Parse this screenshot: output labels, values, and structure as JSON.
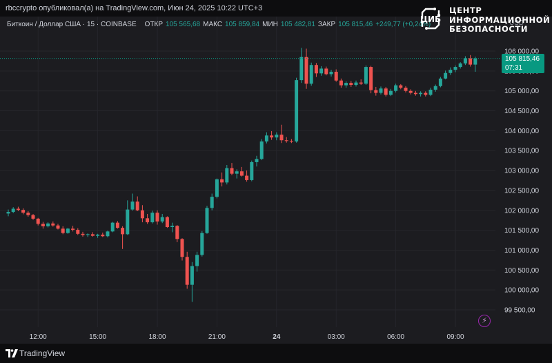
{
  "header": {
    "publisher_line": "rbccrypto опубликовал(а) на TradingView.com, Июн 24, 2025 10:22 UTC+3"
  },
  "legend": {
    "symbol": "Биткоин / Доллар США · 15 · COINBASE",
    "open_label": "ОТКР",
    "open_value": "105 565,68",
    "high_label": "МАКС",
    "high_value": "105 859,84",
    "low_label": "МИН",
    "low_value": "105 482,81",
    "close_label": "ЗАКР",
    "close_value": "105 815,46",
    "change": "+249,77 (+0,24%)"
  },
  "brand": {
    "line1": "ЦЕНТР",
    "line2": "ИНФОРМАЦИОННОЙ",
    "line3": "БЕЗОПАСНОСТИ",
    "emblem_text": "ЦИБ"
  },
  "price_axis": {
    "currency": "USD",
    "current_price": "105 815,46",
    "countdown": "07:31"
  },
  "footer": {
    "brand_name": "TradingView"
  },
  "colors": {
    "up": "#26a69a",
    "down": "#ef5350",
    "background": "#1c1c20",
    "price_tag": "#089981"
  },
  "icons": {
    "alert": "lightning-bolt-icon",
    "logo": "tradingview-logo-icon",
    "brand": "circuit-emblem-icon"
  },
  "chart_data": {
    "type": "candlestick",
    "timeframe_minutes": 15,
    "y_ticks": [
      99500,
      100000,
      100500,
      101000,
      101500,
      102000,
      102500,
      103000,
      103500,
      104000,
      104500,
      105000,
      105500,
      106000
    ],
    "y_tick_labels": [
      "99 500,00",
      "100 000,00",
      "100 500,00",
      "101 000,00",
      "101 500,00",
      "102 000,00",
      "102 500,00",
      "103 000,00",
      "103 500,00",
      "104 000,00",
      "104 500,00",
      "105 000,00",
      "105 500,00",
      "106 000,00"
    ],
    "x_tick_labels": [
      "12:00",
      "15:00",
      "18:00",
      "21:00",
      "24",
      "03:00",
      "06:00",
      "09:00"
    ],
    "x_tick_bar_index": [
      6,
      18,
      30,
      42,
      54,
      66,
      78,
      90
    ],
    "ylim": [
      99200,
      106300
    ],
    "last_price": 105815.46,
    "candles": [
      {
        "o": 101920,
        "h": 102020,
        "l": 101850,
        "c": 101960
      },
      {
        "o": 101960,
        "h": 102080,
        "l": 101930,
        "c": 102040
      },
      {
        "o": 102040,
        "h": 102090,
        "l": 101980,
        "c": 102010
      },
      {
        "o": 102010,
        "h": 102050,
        "l": 101900,
        "c": 101940
      },
      {
        "o": 101940,
        "h": 101980,
        "l": 101840,
        "c": 101880
      },
      {
        "o": 101880,
        "h": 101910,
        "l": 101760,
        "c": 101790
      },
      {
        "o": 101790,
        "h": 101810,
        "l": 101620,
        "c": 101660
      },
      {
        "o": 101660,
        "h": 101710,
        "l": 101540,
        "c": 101600
      },
      {
        "o": 101600,
        "h": 101700,
        "l": 101570,
        "c": 101670
      },
      {
        "o": 101670,
        "h": 101720,
        "l": 101590,
        "c": 101620
      },
      {
        "o": 101620,
        "h": 101660,
        "l": 101520,
        "c": 101540
      },
      {
        "o": 101540,
        "h": 101600,
        "l": 101400,
        "c": 101430
      },
      {
        "o": 101430,
        "h": 101560,
        "l": 101410,
        "c": 101540
      },
      {
        "o": 101540,
        "h": 101610,
        "l": 101470,
        "c": 101510
      },
      {
        "o": 101510,
        "h": 101550,
        "l": 101380,
        "c": 101410
      },
      {
        "o": 101410,
        "h": 101460,
        "l": 101340,
        "c": 101380
      },
      {
        "o": 101380,
        "h": 101420,
        "l": 101330,
        "c": 101400
      },
      {
        "o": 101400,
        "h": 101450,
        "l": 101340,
        "c": 101360
      },
      {
        "o": 101360,
        "h": 101410,
        "l": 101310,
        "c": 101390
      },
      {
        "o": 101390,
        "h": 101440,
        "l": 101330,
        "c": 101350
      },
      {
        "o": 101350,
        "h": 101490,
        "l": 101320,
        "c": 101470
      },
      {
        "o": 101470,
        "h": 101710,
        "l": 101450,
        "c": 101690
      },
      {
        "o": 101690,
        "h": 101730,
        "l": 101540,
        "c": 101560
      },
      {
        "o": 101560,
        "h": 101600,
        "l": 101030,
        "c": 101400
      },
      {
        "o": 101400,
        "h": 102250,
        "l": 101380,
        "c": 102020
      },
      {
        "o": 102020,
        "h": 102420,
        "l": 101990,
        "c": 102220
      },
      {
        "o": 102220,
        "h": 102350,
        "l": 101980,
        "c": 102000
      },
      {
        "o": 102000,
        "h": 102130,
        "l": 101700,
        "c": 101800
      },
      {
        "o": 101800,
        "h": 101910,
        "l": 101660,
        "c": 101700
      },
      {
        "o": 101700,
        "h": 101990,
        "l": 101670,
        "c": 101940
      },
      {
        "o": 101940,
        "h": 102000,
        "l": 101640,
        "c": 101720
      },
      {
        "o": 101720,
        "h": 101910,
        "l": 101680,
        "c": 101830
      },
      {
        "o": 101830,
        "h": 101850,
        "l": 101560,
        "c": 101580
      },
      {
        "o": 101580,
        "h": 101690,
        "l": 101450,
        "c": 101610
      },
      {
        "o": 101610,
        "h": 101630,
        "l": 101200,
        "c": 101280
      },
      {
        "o": 101280,
        "h": 101300,
        "l": 100740,
        "c": 100830
      },
      {
        "o": 100830,
        "h": 100960,
        "l": 100030,
        "c": 100130
      },
      {
        "o": 100130,
        "h": 100700,
        "l": 99700,
        "c": 100600
      },
      {
        "o": 100600,
        "h": 100960,
        "l": 100460,
        "c": 100880
      },
      {
        "o": 100880,
        "h": 101480,
        "l": 100840,
        "c": 101430
      },
      {
        "o": 101430,
        "h": 102110,
        "l": 101410,
        "c": 102060
      },
      {
        "o": 102060,
        "h": 102420,
        "l": 102000,
        "c": 102340
      },
      {
        "o": 102340,
        "h": 102800,
        "l": 102300,
        "c": 102780
      },
      {
        "o": 102780,
        "h": 102950,
        "l": 102600,
        "c": 102700
      },
      {
        "o": 102700,
        "h": 103140,
        "l": 102650,
        "c": 103060
      },
      {
        "o": 103060,
        "h": 103190,
        "l": 102880,
        "c": 102920
      },
      {
        "o": 102920,
        "h": 103030,
        "l": 102800,
        "c": 102980
      },
      {
        "o": 102980,
        "h": 103090,
        "l": 102850,
        "c": 102870
      },
      {
        "o": 102870,
        "h": 103000,
        "l": 102720,
        "c": 102760
      },
      {
        "o": 102760,
        "h": 103250,
        "l": 102730,
        "c": 103210
      },
      {
        "o": 103210,
        "h": 103370,
        "l": 103100,
        "c": 103290
      },
      {
        "o": 103290,
        "h": 103790,
        "l": 103260,
        "c": 103730
      },
      {
        "o": 103730,
        "h": 103960,
        "l": 103680,
        "c": 103880
      },
      {
        "o": 103880,
        "h": 103990,
        "l": 103770,
        "c": 103830
      },
      {
        "o": 103830,
        "h": 103960,
        "l": 103760,
        "c": 103900
      },
      {
        "o": 103900,
        "h": 104150,
        "l": 103690,
        "c": 103760
      },
      {
        "o": 103760,
        "h": 103840,
        "l": 103700,
        "c": 103740
      },
      {
        "o": 103740,
        "h": 103790,
        "l": 103690,
        "c": 103730
      },
      {
        "o": 103730,
        "h": 105330,
        "l": 103700,
        "c": 105270
      },
      {
        "o": 105270,
        "h": 106080,
        "l": 105200,
        "c": 105850
      },
      {
        "o": 105850,
        "h": 106060,
        "l": 105050,
        "c": 105180
      },
      {
        "o": 105180,
        "h": 105710,
        "l": 105130,
        "c": 105650
      },
      {
        "o": 105650,
        "h": 105700,
        "l": 105350,
        "c": 105440
      },
      {
        "o": 105440,
        "h": 105620,
        "l": 105380,
        "c": 105560
      },
      {
        "o": 105560,
        "h": 105610,
        "l": 105390,
        "c": 105420
      },
      {
        "o": 105420,
        "h": 105530,
        "l": 105360,
        "c": 105480
      },
      {
        "o": 105480,
        "h": 105540,
        "l": 105230,
        "c": 105260
      },
      {
        "o": 105260,
        "h": 105310,
        "l": 105080,
        "c": 105140
      },
      {
        "o": 105140,
        "h": 105240,
        "l": 105080,
        "c": 105200
      },
      {
        "o": 105200,
        "h": 105250,
        "l": 105100,
        "c": 105150
      },
      {
        "o": 105150,
        "h": 105260,
        "l": 105110,
        "c": 105210
      },
      {
        "o": 105210,
        "h": 105290,
        "l": 105150,
        "c": 105180
      },
      {
        "o": 105180,
        "h": 105640,
        "l": 105150,
        "c": 105600
      },
      {
        "o": 105600,
        "h": 105630,
        "l": 104940,
        "c": 105020
      },
      {
        "o": 105020,
        "h": 105100,
        "l": 104880,
        "c": 104950
      },
      {
        "o": 104950,
        "h": 105110,
        "l": 104910,
        "c": 105060
      },
      {
        "o": 105060,
        "h": 105100,
        "l": 104860,
        "c": 104900
      },
      {
        "o": 104900,
        "h": 105050,
        "l": 104870,
        "c": 105000
      },
      {
        "o": 105000,
        "h": 105180,
        "l": 104960,
        "c": 105140
      },
      {
        "o": 105140,
        "h": 105170,
        "l": 105040,
        "c": 105080
      },
      {
        "o": 105080,
        "h": 105120,
        "l": 104960,
        "c": 105000
      },
      {
        "o": 105000,
        "h": 105040,
        "l": 104910,
        "c": 104950
      },
      {
        "o": 104950,
        "h": 105000,
        "l": 104880,
        "c": 104920
      },
      {
        "o": 104920,
        "h": 104990,
        "l": 104860,
        "c": 104950
      },
      {
        "o": 104950,
        "h": 104990,
        "l": 104860,
        "c": 104900
      },
      {
        "o": 104900,
        "h": 105080,
        "l": 104870,
        "c": 105030
      },
      {
        "o": 105030,
        "h": 105160,
        "l": 104980,
        "c": 105120
      },
      {
        "o": 105120,
        "h": 105350,
        "l": 105090,
        "c": 105310
      },
      {
        "o": 105310,
        "h": 105510,
        "l": 105290,
        "c": 105450
      },
      {
        "o": 105450,
        "h": 105590,
        "l": 105400,
        "c": 105530
      },
      {
        "o": 105530,
        "h": 105640,
        "l": 105470,
        "c": 105600
      },
      {
        "o": 105600,
        "h": 105720,
        "l": 105560,
        "c": 105690
      },
      {
        "o": 105690,
        "h": 105870,
        "l": 105650,
        "c": 105820
      },
      {
        "o": 105820,
        "h": 105900,
        "l": 105610,
        "c": 105660
      },
      {
        "o": 105660,
        "h": 105860,
        "l": 105480,
        "c": 105815.46
      }
    ]
  }
}
